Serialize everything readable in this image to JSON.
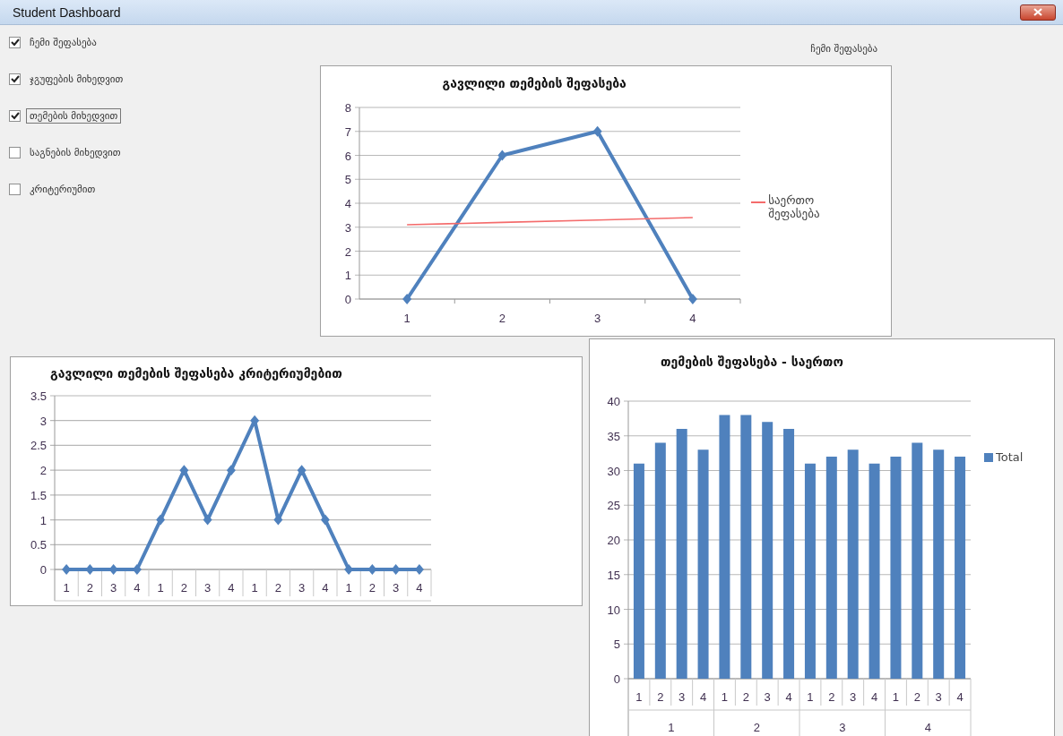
{
  "window": {
    "title": "Student Dashboard"
  },
  "options": [
    {
      "label": "ჩემი შეფასება",
      "checked": true,
      "focused": false
    },
    {
      "label": "ჯგუფების მიხედვით",
      "checked": true,
      "focused": false
    },
    {
      "label": "თემების მიხედვით",
      "checked": true,
      "focused": true
    },
    {
      "label": "საგნების მიხედვით",
      "checked": false,
      "focused": false
    },
    {
      "label": "კრიტერიუმით",
      "checked": false,
      "focused": false
    }
  ],
  "view_label": "ჩემი შეფასება",
  "charts": [
    {
      "chart_data": {
        "type": "line",
        "title": "გავლილი თემების შეფასება",
        "categories": [
          "1",
          "2",
          "3",
          "4"
        ],
        "ylim": [
          0,
          8
        ],
        "yticks": [
          0,
          1,
          2,
          3,
          4,
          5,
          6,
          7,
          8
        ],
        "series": [
          {
            "marker": "diamond",
            "color": "#4f81bd",
            "values": [
              0,
              6,
              7,
              0
            ]
          },
          {
            "name": "საერთო შეფასება",
            "color": "#f46b6b",
            "values": [
              3.1,
              3.2,
              3.3,
              3.4
            ]
          }
        ],
        "grid": true
      }
    },
    {
      "chart_data": {
        "type": "line",
        "title": "გავლილი თემების შეფასება კრიტერიუმებით",
        "categories": [
          "1",
          "2",
          "3",
          "4",
          "1",
          "2",
          "3",
          "4",
          "1",
          "2",
          "3",
          "4",
          "1",
          "2",
          "3",
          "4"
        ],
        "ylim": [
          0,
          3.5
        ],
        "yticks": [
          0,
          0.5,
          1,
          1.5,
          2,
          2.5,
          3,
          3.5
        ],
        "series": [
          {
            "marker": "diamond",
            "color": "#4f81bd",
            "values": [
              0,
              0,
              0,
              0,
              1,
              2,
              1,
              2,
              3,
              1,
              2,
              1,
              0,
              0,
              0,
              0
            ]
          }
        ],
        "grid": true
      }
    },
    {
      "chart_data": {
        "type": "bar",
        "title": "თემების შეფასება - საერთო",
        "categories": [
          "1",
          "2",
          "3",
          "4",
          "1",
          "2",
          "3",
          "4",
          "1",
          "2",
          "3",
          "4",
          "1",
          "2",
          "3",
          "4"
        ],
        "annotations": [
          {
            "text": "1"
          },
          {
            "text": "2"
          },
          {
            "text": "3"
          },
          {
            "text": "4"
          }
        ],
        "grid": true,
        "ylim": [
          0,
          40
        ],
        "yticks": [
          0,
          5,
          10,
          15,
          20,
          25,
          30,
          35,
          40
        ],
        "series": [
          {
            "name": "Total",
            "color": "#4f81bd",
            "values": [
              31,
              34,
              36,
              33,
              38,
              38,
              37,
              36,
              31,
              32,
              33,
              31,
              32,
              34,
              33,
              32
            ]
          }
        ]
      }
    }
  ]
}
